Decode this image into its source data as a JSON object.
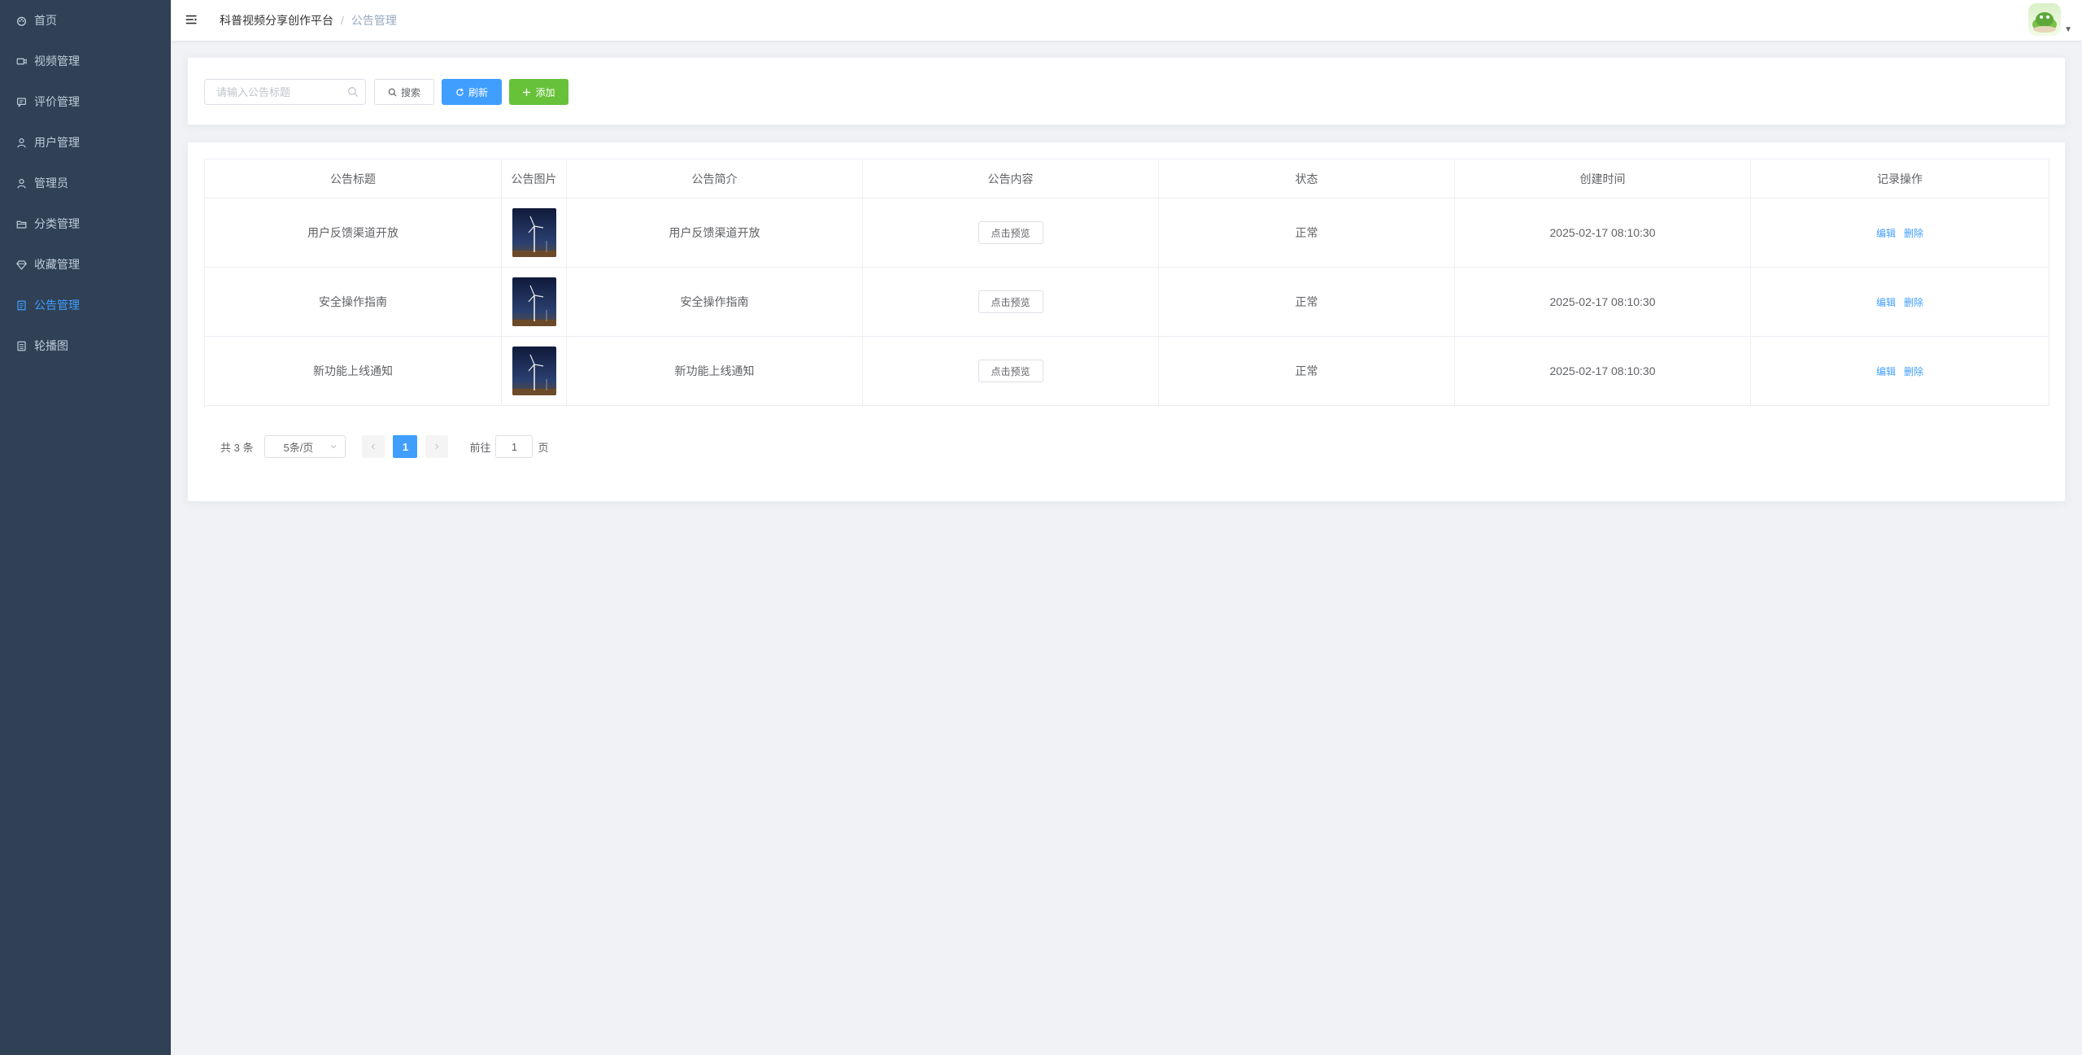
{
  "sidebar": {
    "items": [
      {
        "label": "首页",
        "icon": "dashboard-icon",
        "active": false
      },
      {
        "label": "视频管理",
        "icon": "video-icon",
        "active": false
      },
      {
        "label": "评价管理",
        "icon": "comment-icon",
        "active": false
      },
      {
        "label": "用户管理",
        "icon": "user-icon",
        "active": false
      },
      {
        "label": "管理员",
        "icon": "admin-icon",
        "active": false
      },
      {
        "label": "分类管理",
        "icon": "folder-icon",
        "active": false
      },
      {
        "label": "收藏管理",
        "icon": "diamond-icon",
        "active": false
      },
      {
        "label": "公告管理",
        "icon": "notice-icon",
        "active": true
      },
      {
        "label": "轮播图",
        "icon": "document-icon",
        "active": false
      }
    ]
  },
  "header": {
    "breadcrumb": [
      "科普视频分享创作平台",
      "公告管理"
    ],
    "separator": "/"
  },
  "search": {
    "placeholder": "请输入公告标题",
    "search_label": "搜索",
    "refresh_label": "刷新",
    "add_label": "添加"
  },
  "table": {
    "columns": [
      "公告标题",
      "公告图片",
      "公告简介",
      "公告内容",
      "状态",
      "创建时间",
      "记录操作"
    ],
    "rows": [
      {
        "title": "用户反馈渠道开放",
        "summary": "用户反馈渠道开放",
        "content_btn": "点击预览",
        "status": "正常",
        "created": "2025-02-17 08:10:30",
        "edit": "编辑",
        "delete": "删除"
      },
      {
        "title": "安全操作指南",
        "summary": "安全操作指南",
        "content_btn": "点击预览",
        "status": "正常",
        "created": "2025-02-17 08:10:30",
        "edit": "编辑",
        "delete": "删除"
      },
      {
        "title": "新功能上线通知",
        "summary": "新功能上线通知",
        "content_btn": "点击预览",
        "status": "正常",
        "created": "2025-02-17 08:10:30",
        "edit": "编辑",
        "delete": "删除"
      }
    ]
  },
  "pagination": {
    "total": "共 3 条",
    "page_size": "5条/页",
    "current_page": "1",
    "goto_prefix": "前往",
    "goto_value": "1",
    "goto_suffix": "页"
  },
  "colors": {
    "sidebar_bg": "#304156",
    "accent": "#409eff",
    "success": "#67c23a"
  }
}
